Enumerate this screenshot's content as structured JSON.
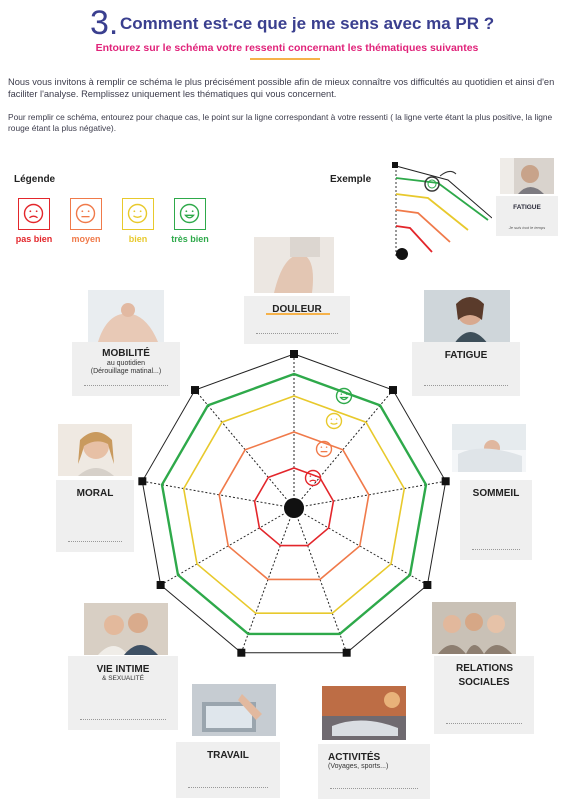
{
  "header": {
    "number": "3.",
    "title": "Comment est-ce que je me sens avec ma PR ?",
    "subtitle": "Entourez sur le schéma votre ressenti concernant les thématiques suivantes"
  },
  "intro": {
    "paragraph1": "Nous vous invitons à remplir ce schéma le plus précisément possible afin de mieux connaître vos difficultés au quotidien et ainsi d'en faciliter l'analyse. Remplissez uniquement les thématiques qui vous concernent.",
    "paragraph2": "Pour remplir ce schéma, entourez pour chaque cas, le point sur la ligne correspondant à votre ressenti ( la ligne verte étant la plus positive, la ligne rouge étant la plus négative)."
  },
  "legend": {
    "title": "Légende",
    "items": [
      {
        "label": "pas bien",
        "color": "#e3262b",
        "face": "sad"
      },
      {
        "label": "moyen",
        "color": "#f07a4a",
        "face": "neutral"
      },
      {
        "label": "bien",
        "color": "#e8c92c",
        "face": "smile"
      },
      {
        "label": "très bien",
        "color": "#2ea94a",
        "face": "happy"
      }
    ]
  },
  "example": {
    "title": "Exemple",
    "card_label": "FATIGUE",
    "card_note": "Je suis tout le temps"
  },
  "levels": {
    "colors": [
      "#e3262b",
      "#f07a4a",
      "#e8c92c",
      "#2ea94a"
    ]
  },
  "themes": {
    "douleur": {
      "label": "DOULEUR"
    },
    "fatigue": {
      "label": "FATIGUE"
    },
    "sommeil": {
      "label": "SOMMEIL"
    },
    "relations": {
      "label": "RELATIONS SOCIALES"
    },
    "activites": {
      "label": "ACTIVITÉS",
      "sub": "(Voyages, sports...)"
    },
    "travail": {
      "label": "TRAVAIL"
    },
    "vie_intime": {
      "label": "VIE INTIME",
      "sub": "& SEXUALITÉ"
    },
    "moral": {
      "label": "MORAL"
    },
    "mobilite": {
      "label": "MOBILITÉ",
      "sub": "au quotidien (Dérouillage matinal...)"
    }
  }
}
